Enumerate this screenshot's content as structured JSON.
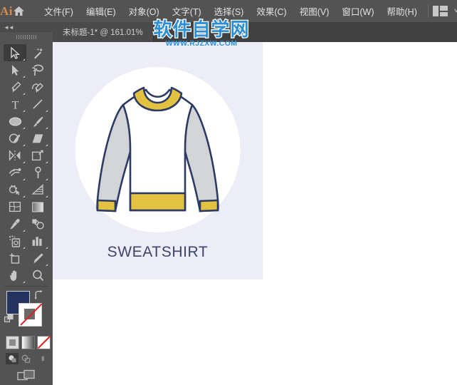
{
  "app": {
    "logo": "Ai",
    "home_icon": "home-icon",
    "workspace_icon": "workspace-switcher-icon",
    "chevron": "˅"
  },
  "menubar": {
    "items": [
      {
        "label": "文件(F)",
        "name": "menu-file"
      },
      {
        "label": "编辑(E)",
        "name": "menu-edit"
      },
      {
        "label": "对象(O)",
        "name": "menu-object"
      },
      {
        "label": "文字(T)",
        "name": "menu-type"
      },
      {
        "label": "选择(S)",
        "name": "menu-select"
      },
      {
        "label": "效果(C)",
        "name": "menu-effect"
      },
      {
        "label": "视图(V)",
        "name": "menu-view"
      },
      {
        "label": "窗口(W)",
        "name": "menu-window"
      },
      {
        "label": "帮助(H)",
        "name": "menu-help"
      }
    ]
  },
  "document": {
    "tab_label": "未标题-1* @ 161.01%",
    "title": "未标题-1",
    "modified": true,
    "zoom": "161.01%"
  },
  "watermark": {
    "main": "软件自学网",
    "sub": "WWW.RJZXW.COM",
    "color": "#2b8fd8"
  },
  "toolbar": {
    "collapse_icon": "double-chevron-left-icon",
    "grip": "drag-grip-handle",
    "tools": [
      {
        "name": "selection-tool",
        "selected": true,
        "flyout": true
      },
      {
        "name": "magic-wand-tool",
        "selected": false,
        "flyout": false
      },
      {
        "name": "direct-selection-tool",
        "selected": false,
        "flyout": true
      },
      {
        "name": "lasso-tool",
        "selected": false,
        "flyout": false
      },
      {
        "name": "pen-tool",
        "selected": false,
        "flyout": true
      },
      {
        "name": "curvature-tool",
        "selected": false,
        "flyout": false
      },
      {
        "name": "type-tool",
        "selected": false,
        "flyout": true
      },
      {
        "name": "line-segment-tool",
        "selected": false,
        "flyout": true
      },
      {
        "name": "ellipse-tool",
        "selected": false,
        "flyout": true
      },
      {
        "name": "paintbrush-tool",
        "selected": false,
        "flyout": true
      },
      {
        "name": "shaper-tool",
        "selected": false,
        "flyout": true
      },
      {
        "name": "eraser-tool",
        "selected": false,
        "flyout": true
      },
      {
        "name": "reflect-tool",
        "selected": false,
        "flyout": true
      },
      {
        "name": "free-transform-tool",
        "selected": false,
        "flyout": true
      },
      {
        "name": "width-tool",
        "selected": false,
        "flyout": true
      },
      {
        "name": "puppet-warp-tool",
        "selected": false,
        "flyout": true
      },
      {
        "name": "shape-builder-tool",
        "selected": false,
        "flyout": true
      },
      {
        "name": "perspective-grid-tool",
        "selected": false,
        "flyout": true
      },
      {
        "name": "mesh-tool",
        "selected": false,
        "flyout": false
      },
      {
        "name": "gradient-tool",
        "selected": false,
        "flyout": false
      },
      {
        "name": "eyedropper-tool",
        "selected": false,
        "flyout": true
      },
      {
        "name": "blend-tool",
        "selected": false,
        "flyout": false
      },
      {
        "name": "symbol-sprayer-tool",
        "selected": false,
        "flyout": true
      },
      {
        "name": "column-graph-tool",
        "selected": false,
        "flyout": true
      },
      {
        "name": "artboard-tool",
        "selected": false,
        "flyout": false
      },
      {
        "name": "slice-tool",
        "selected": false,
        "flyout": true
      },
      {
        "name": "hand-tool",
        "selected": false,
        "flyout": true
      },
      {
        "name": "zoom-tool",
        "selected": false,
        "flyout": false
      }
    ],
    "colors": {
      "fill": "#243260",
      "stroke": "#ffffff",
      "stroke_is_none": true,
      "swap_icon": "swap-fill-stroke-icon",
      "default_icon": "default-fill-stroke-icon"
    },
    "paint_modes": [
      {
        "name": "color-mode-button",
        "label": "color"
      },
      {
        "name": "gradient-mode-button",
        "label": "gradient"
      },
      {
        "name": "none-mode-button",
        "label": "none"
      }
    ],
    "draw_modes": [
      {
        "name": "draw-normal-button",
        "active": true
      },
      {
        "name": "draw-behind-button",
        "active": false
      },
      {
        "name": "draw-inside-button",
        "active": false
      }
    ],
    "screen_mode": {
      "name": "change-screen-mode-button"
    }
  },
  "artwork": {
    "label": "SWEATSHIRT",
    "panel_bg": "#ededf8",
    "circle_bg": "#ffffff",
    "outline": "#2c3b63",
    "accent_yellow": "#e2c240",
    "sleeve_gray": "#d3d4d6",
    "body_white": "#ffffff",
    "label_color": "#3c4568"
  }
}
